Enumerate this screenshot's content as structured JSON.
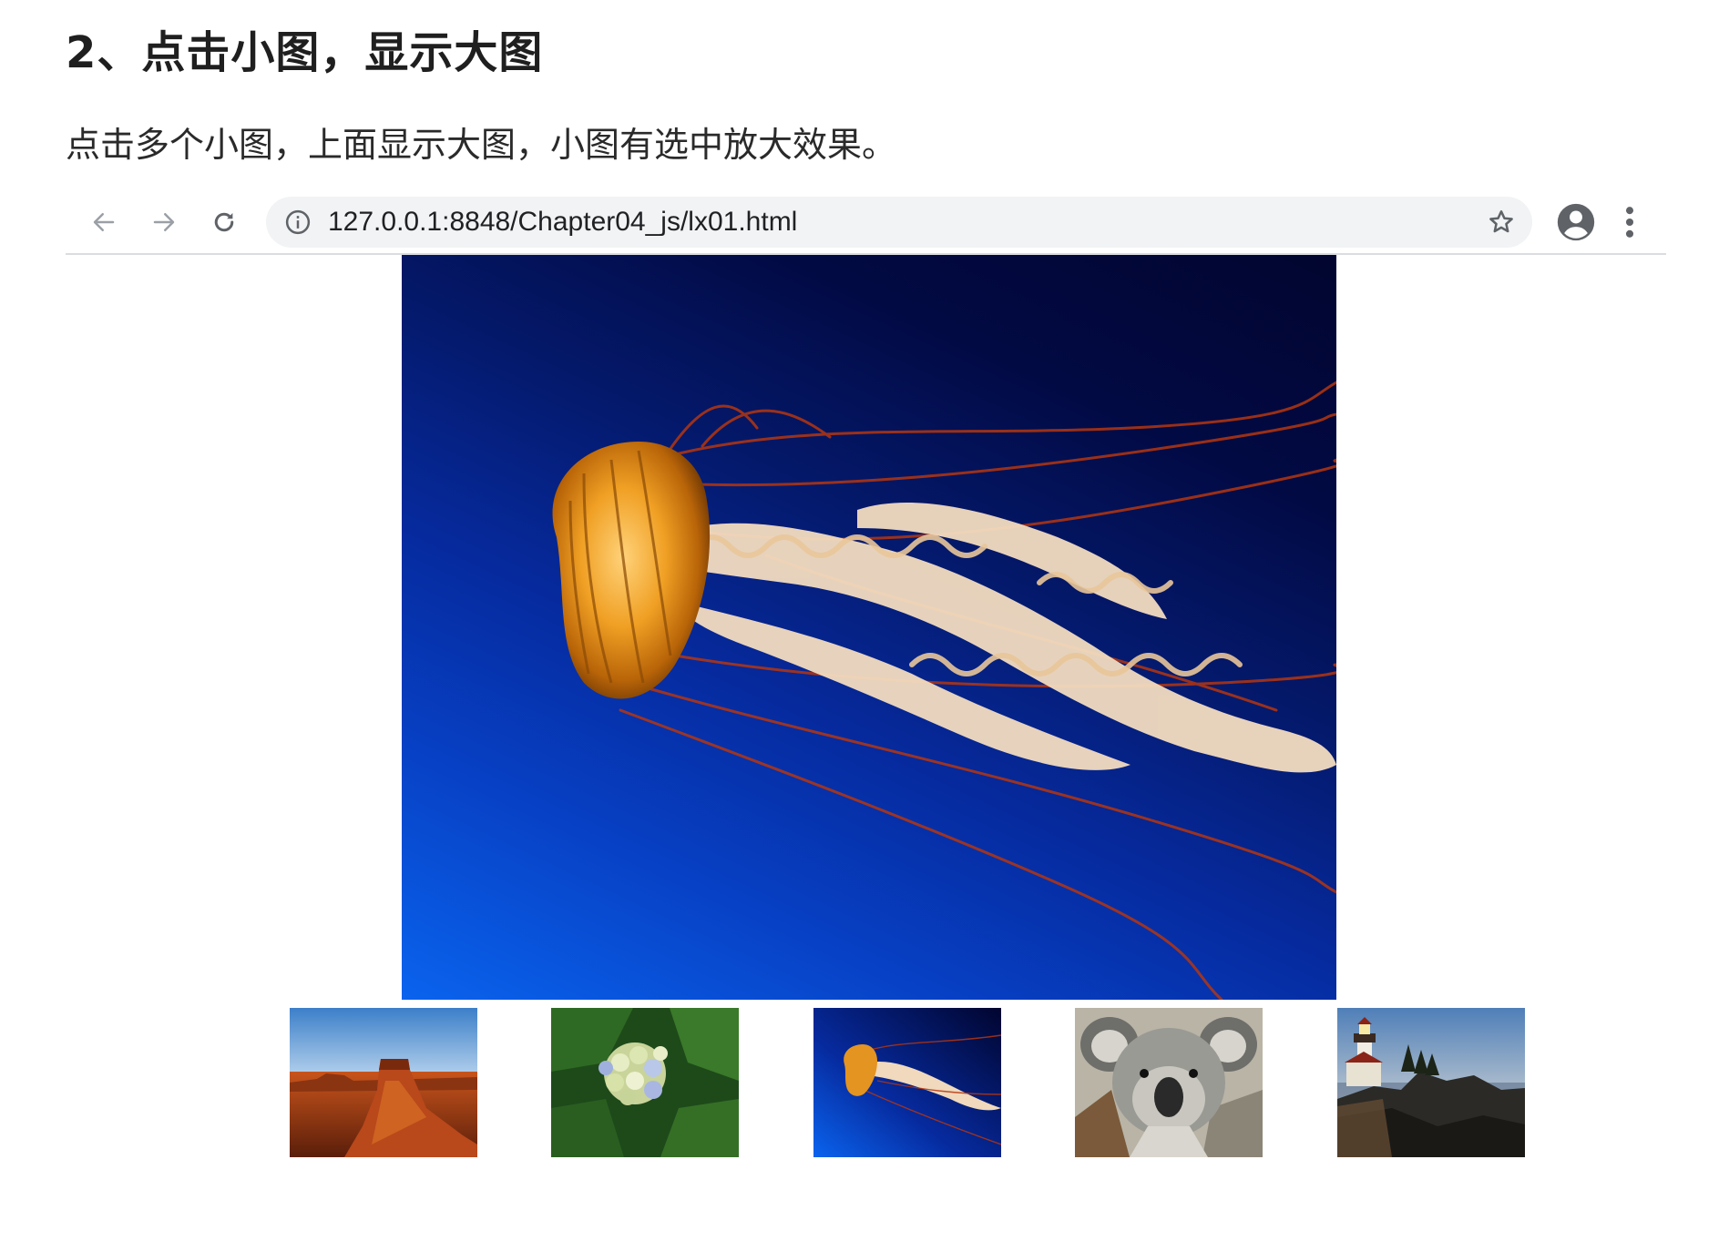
{
  "document": {
    "heading": "2、点击小图，显示大图",
    "description": "点击多个小图，上面显示大图，小图有选中放大效果。"
  },
  "browser": {
    "url": "127.0.0.1:8848/Chapter04_js/lx01.html",
    "icons": {
      "back": "arrow-left-icon",
      "forward": "arrow-right-icon",
      "reload": "reload-icon",
      "site_info": "info-icon",
      "bookmark": "star-icon",
      "account": "account-icon",
      "menu": "more-vertical-icon"
    }
  },
  "gallery": {
    "main_image": "jellyfish",
    "thumbnails": [
      "desert",
      "hydrangea",
      "jellyfish",
      "koala",
      "lighthouse"
    ],
    "selected_index": 2
  }
}
